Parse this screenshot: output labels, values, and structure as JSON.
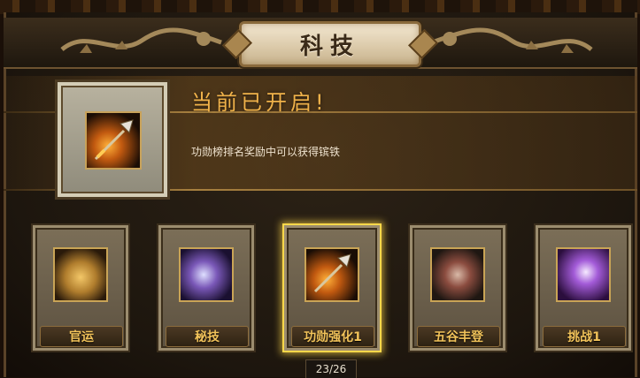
{
  "header": {
    "title": "科技"
  },
  "featured": {
    "status_title": "当前已开启!",
    "description": "功勋榜排名奖励中可以获得镔铁",
    "icon": "spear-icon"
  },
  "tech_items": [
    {
      "label": "官运",
      "icon": "treasure-chest-icon"
    },
    {
      "label": "秘技",
      "icon": "mystic-blade-icon"
    },
    {
      "label": "功勋强化1",
      "icon": "spear-icon",
      "selected": true
    },
    {
      "label": "五谷丰登",
      "icon": "grain-cart-icon"
    },
    {
      "label": "挑战1",
      "icon": "challenge-scroll-icon"
    }
  ],
  "pagination": {
    "text": "23/26"
  },
  "colors": {
    "accent_gold": "#f0b24a",
    "selected_border": "#ffd84a"
  }
}
